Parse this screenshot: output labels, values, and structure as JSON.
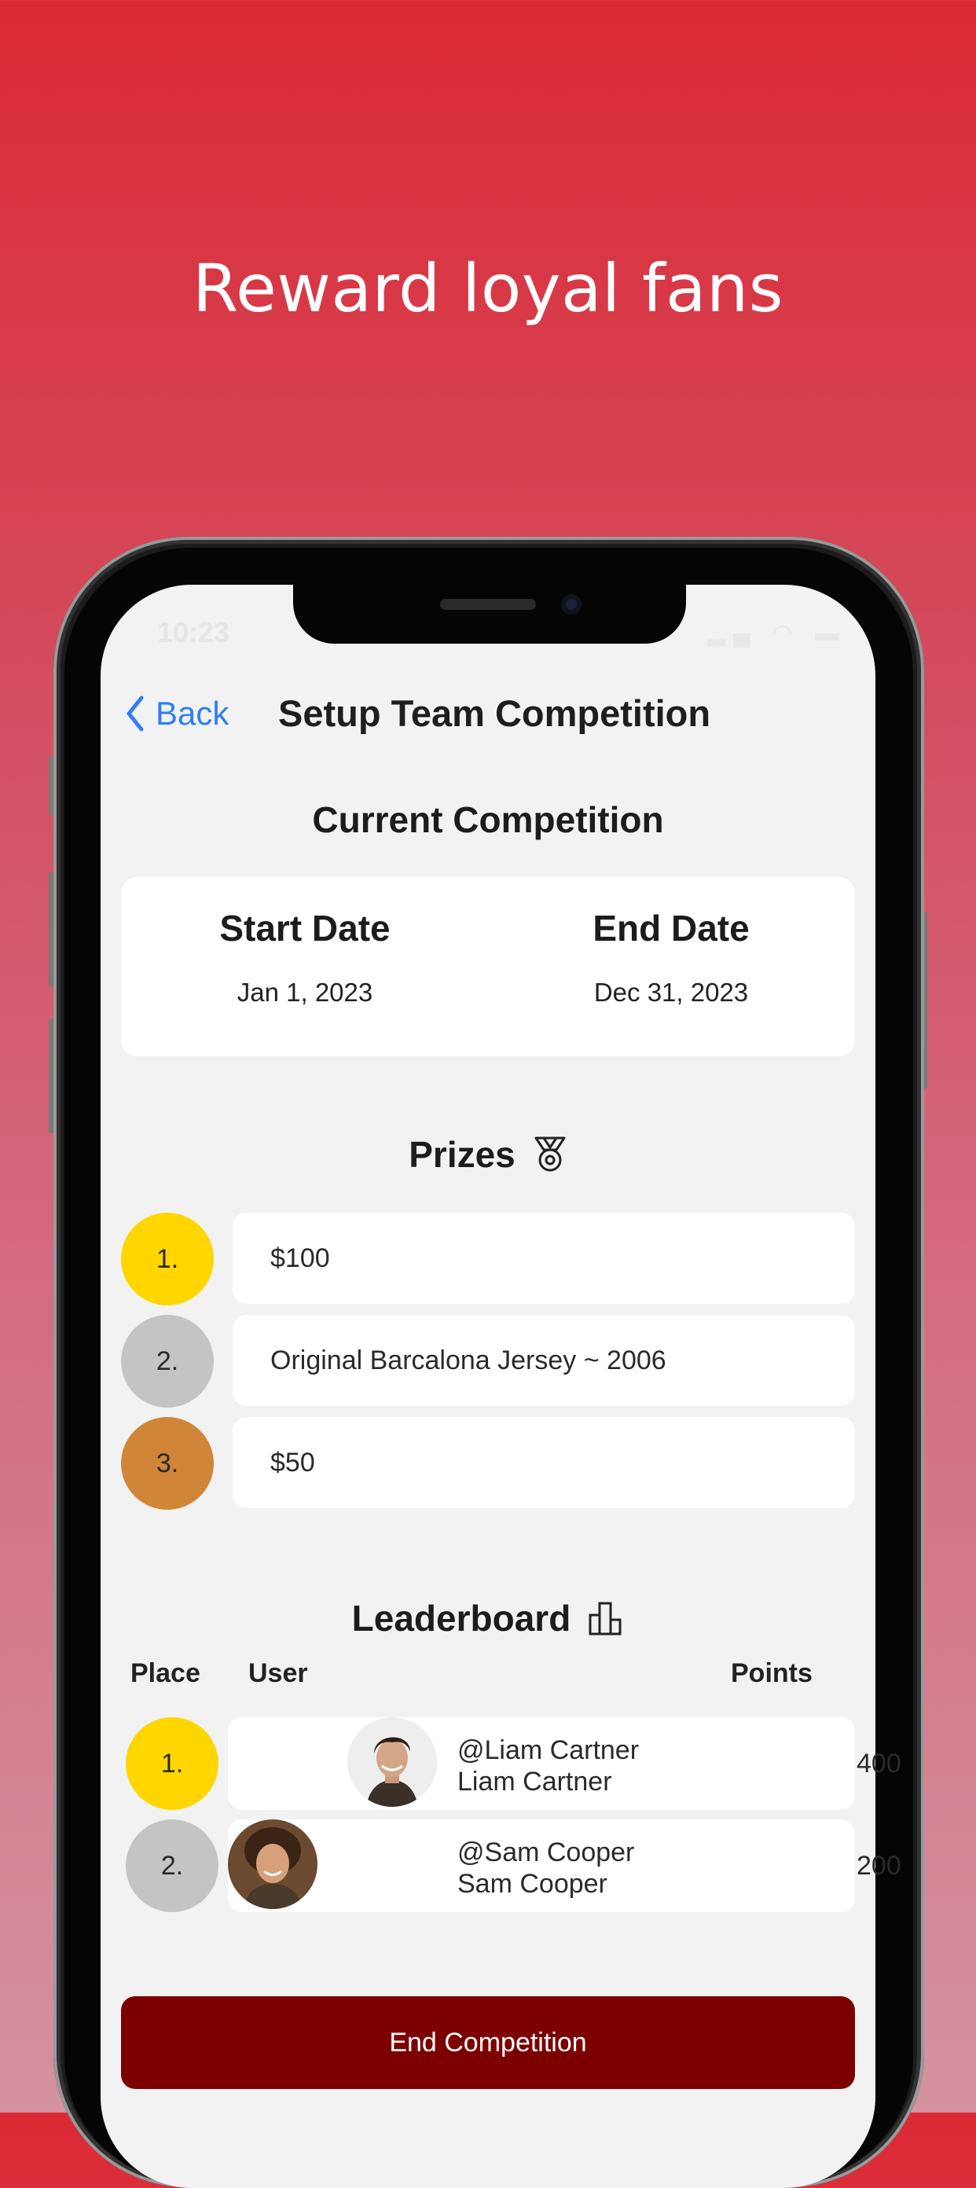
{
  "headline": "Reward loyal fans",
  "status_bar": {
    "time": "10:23"
  },
  "nav": {
    "back_label": "Back",
    "title": "Setup Team Competition"
  },
  "current_competition": {
    "title": "Current Competition",
    "start_label": "Start Date",
    "start_value": "Jan 1, 2023",
    "end_label": "End Date",
    "end_value": "Dec 31, 2023"
  },
  "prizes": {
    "title": "Prizes",
    "items": [
      {
        "place": "1.",
        "label": "$100",
        "color": "#FFD600"
      },
      {
        "place": "2.",
        "label": "Original Barcalona Jersey ~ 2006",
        "color": "#C4C4C4"
      },
      {
        "place": "3.",
        "label": "$50",
        "color": "#D08538"
      }
    ]
  },
  "leaderboard": {
    "title": "Leaderboard",
    "col_place": "Place",
    "col_user": "User",
    "col_points": "Points",
    "rows": [
      {
        "place": "1.",
        "handle": "@Liam Cartner",
        "name": "Liam Cartner",
        "points": "400",
        "color": "#FFD600"
      },
      {
        "place": "2.",
        "handle": "@Sam Cooper",
        "name": "Sam Cooper",
        "points": "200",
        "color": "#C4C4C4"
      }
    ]
  },
  "end_button_label": "End Competition",
  "colors": {
    "accent_link": "#2F7EF6",
    "end_button": "#7D0000",
    "background_top": "#DC2A35"
  }
}
